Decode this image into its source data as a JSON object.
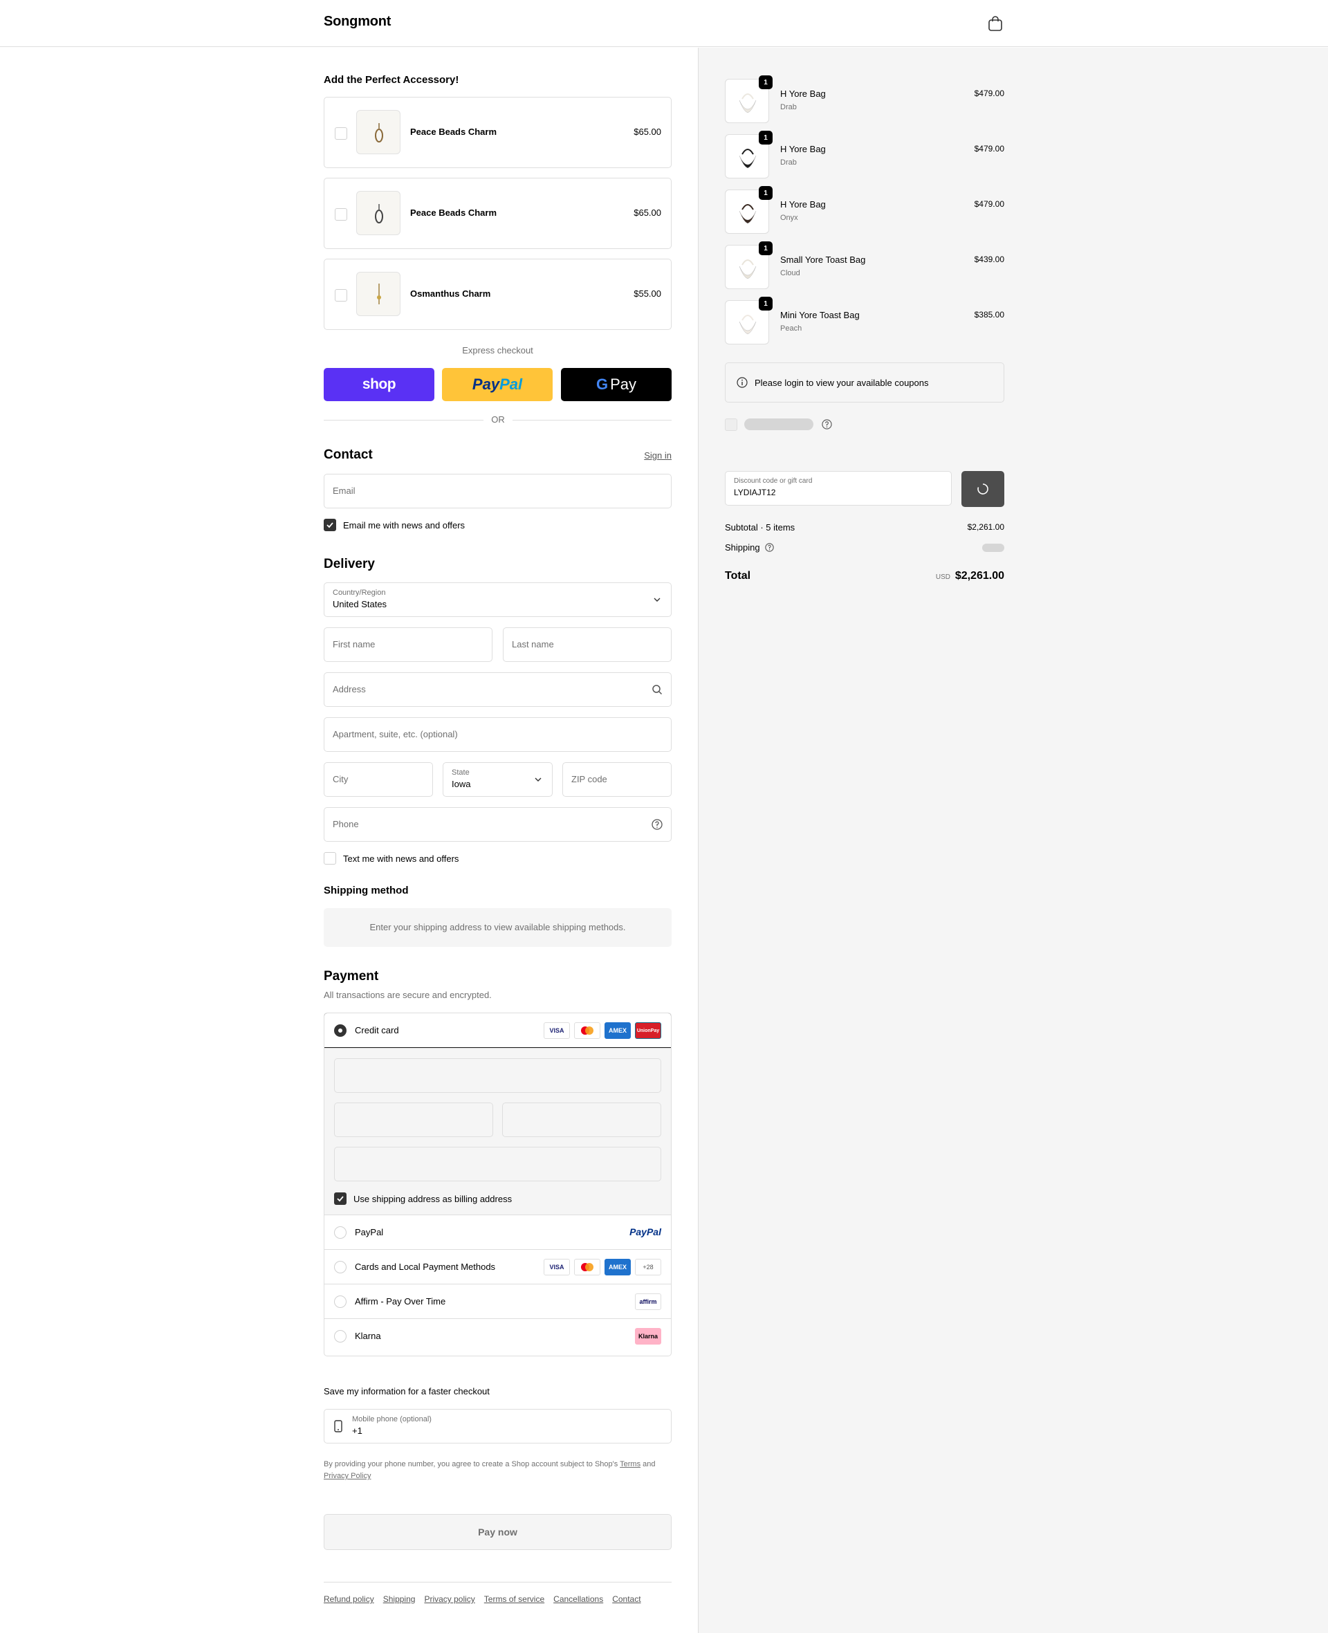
{
  "header": {
    "brand": "Songmont"
  },
  "accessories": {
    "title": "Add the Perfect Accessory!",
    "items": [
      {
        "name": "Peace Beads Charm",
        "price": "$65.00"
      },
      {
        "name": "Peace Beads Charm",
        "price": "$65.00"
      },
      {
        "name": "Osmanthus Charm",
        "price": "$55.00"
      }
    ]
  },
  "express": {
    "label": "Express checkout",
    "shop": "shop",
    "paypal_a": "Pay",
    "paypal_b": "Pal",
    "gpay_g": "G",
    "gpay_text": "Pay",
    "or": "OR"
  },
  "contact": {
    "title": "Contact",
    "signin": "Sign in",
    "email_placeholder": "Email",
    "news_label": "Email me with news and offers",
    "news_checked": true
  },
  "delivery": {
    "title": "Delivery",
    "country_label": "Country/Region",
    "country_value": "United States",
    "first_name": "First name",
    "last_name": "Last name",
    "address": "Address",
    "apartment": "Apartment, suite, etc. (optional)",
    "city": "City",
    "state_label": "State",
    "state_value": "Iowa",
    "zip": "ZIP code",
    "phone": "Phone",
    "text_label": "Text me with news and offers",
    "text_checked": false
  },
  "shipping": {
    "title": "Shipping method",
    "message": "Enter your shipping address to view available shipping methods."
  },
  "payment": {
    "title": "Payment",
    "subtitle": "All transactions are secure and encrypted.",
    "credit_card": "Credit card",
    "billing_label": "Use shipping address as billing address",
    "billing_checked": true,
    "options": [
      "PayPal",
      "Cards and Local Payment Methods",
      "Affirm - Pay Over Time",
      "Klarna"
    ],
    "logos": {
      "visa": "VISA",
      "amex": "AMEX",
      "unionpay": "UnionPay",
      "more": "+28",
      "paypal": "PayPal",
      "affirm": "affirm",
      "klarna": "Klarna"
    }
  },
  "save": {
    "title": "Save my information for a faster checkout",
    "phone_label": "Mobile phone (optional)",
    "phone_value": "+1",
    "terms_pre": "By providing your phone number, you agree to create a Shop account subject to Shop's",
    "terms_link": "Terms",
    "terms_and": "and",
    "privacy_link": "Privacy Policy"
  },
  "paynow": "Pay now",
  "footer": [
    "Refund policy",
    "Shipping",
    "Privacy policy",
    "Terms of service",
    "Cancellations",
    "Contact"
  ],
  "cart": {
    "items": [
      {
        "qty": "1",
        "name": "H Yore Bag",
        "variant": "Drab",
        "price": "$479.00",
        "color": "#ece8e0"
      },
      {
        "qty": "1",
        "name": "H Yore Bag",
        "variant": "Drab",
        "price": "$479.00",
        "color": "#1e1e1e"
      },
      {
        "qty": "1",
        "name": "H Yore Bag",
        "variant": "Onyx",
        "price": "$479.00",
        "color": "#3a2a22"
      },
      {
        "qty": "1",
        "name": "Small Yore Toast Bag",
        "variant": "Cloud",
        "price": "$439.00",
        "color": "#e9e4da"
      },
      {
        "qty": "1",
        "name": "Mini Yore Toast Bag",
        "variant": "Peach",
        "price": "$385.00",
        "color": "#efe9e2"
      }
    ],
    "coupon_message": "Please login to view your available coupons",
    "discount_label": "Discount code or gift card",
    "discount_value": "LYDIAJT12",
    "subtotal_label": "Subtotal · 5 items",
    "subtotal_value": "$2,261.00",
    "shipping_label": "Shipping",
    "total_label": "Total",
    "currency": "USD",
    "total_value": "$2,261.00"
  }
}
